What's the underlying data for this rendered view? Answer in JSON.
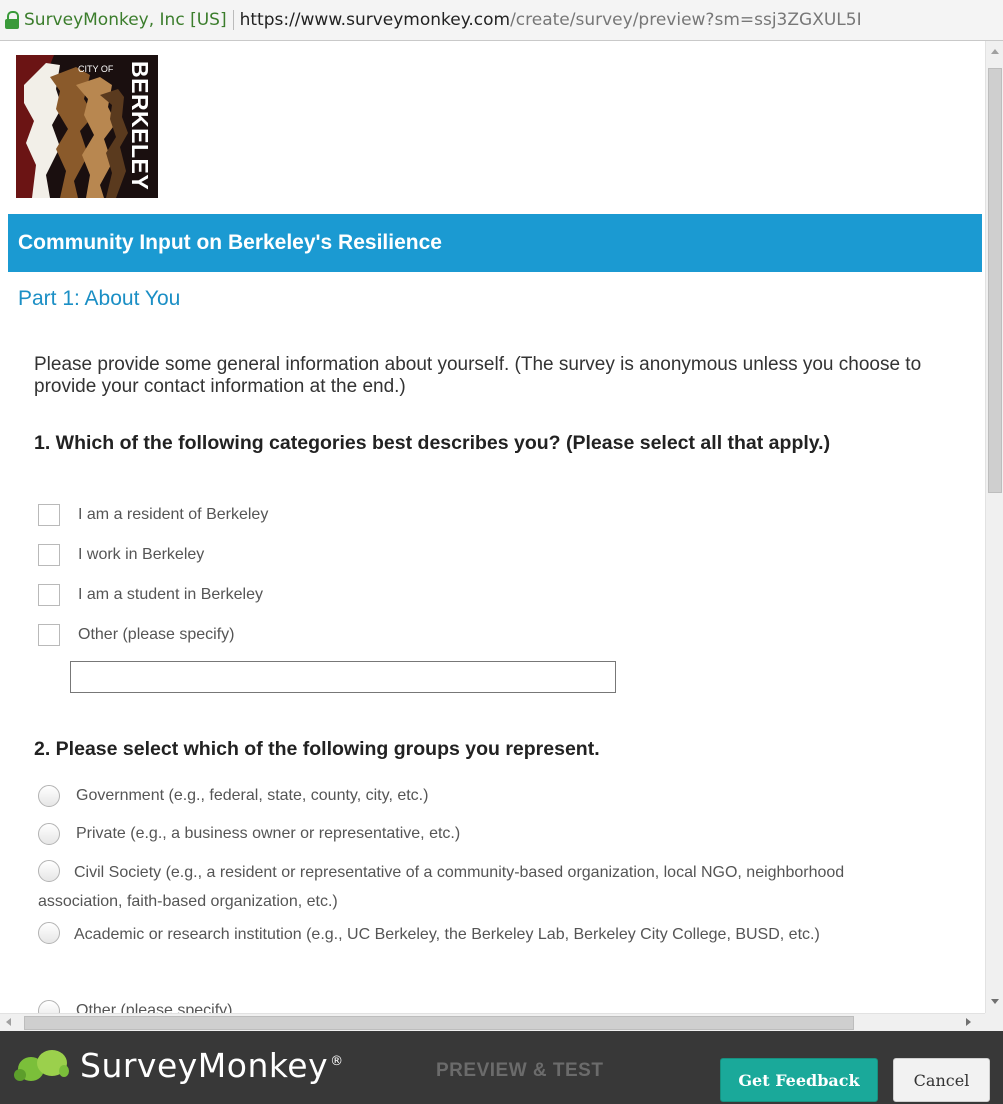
{
  "browser": {
    "site_identity": "SurveyMonkey, Inc [US]",
    "url_host": "https://www.surveymonkey.com",
    "url_path": "/create/survey/preview?sm=ssj3ZGXUL5I"
  },
  "logo": {
    "line1": "CITY OF",
    "line2": "BERKELEY"
  },
  "survey": {
    "title": "Community Input on Berkeley's Resilience",
    "part_title": "Part 1: About You",
    "intro": "Please provide some general information about yourself. (The survey is anonymous unless you choose to provide your contact information at the end.)",
    "q1": {
      "text": "1. Which of the following categories best describes you? (Please select all that apply.)",
      "options": [
        "I am a resident of Berkeley",
        "I work in Berkeley",
        "I am a student in Berkeley",
        "Other (please specify)"
      ],
      "other_value": ""
    },
    "q2": {
      "text": "2. Please select which of the following groups you represent.",
      "options": [
        "Government (e.g., federal, state, county, city, etc.)",
        "Private (e.g., a business owner or representative, etc.)",
        "Civil Society (e.g., a resident or representative of a community-based organization, local NGO, neighborhood association, faith-based organization, etc.)",
        "Academic or research institution (e.g., UC Berkeley, the Berkeley Lab, Berkeley City College, BUSD, etc.)",
        "Other (please specify)"
      ]
    }
  },
  "footer": {
    "brand": "SurveyMonkey",
    "registered": "®",
    "mode_label": "PREVIEW & TEST",
    "feedback_button": "Get Feedback",
    "cancel_button": "Cancel"
  },
  "colors": {
    "banner": "#1b9ad2",
    "feedback_button": "#1aa99a",
    "footer": "#383838"
  }
}
